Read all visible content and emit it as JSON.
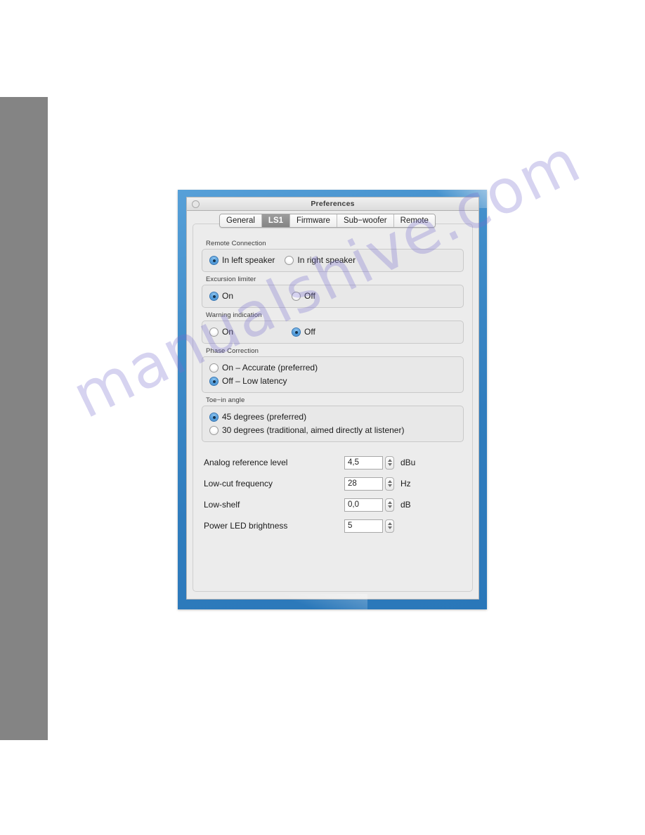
{
  "window": {
    "title": "Preferences",
    "close_button": "close-button"
  },
  "tabs": [
    {
      "label": "General",
      "selected": false
    },
    {
      "label": "LS1",
      "selected": true
    },
    {
      "label": "Firmware",
      "selected": false
    },
    {
      "label": "Sub−woofer",
      "selected": false
    },
    {
      "label": "Remote",
      "selected": false
    }
  ],
  "groups": [
    {
      "label": "Remote Connection",
      "layout": "inline",
      "options": [
        {
          "label": "In left speaker",
          "selected": true
        },
        {
          "label": "In right speaker",
          "selected": false
        }
      ]
    },
    {
      "label": "Excursion limiter",
      "layout": "columns",
      "options": [
        {
          "label": "On",
          "selected": true
        },
        {
          "label": "Off",
          "selected": false
        }
      ]
    },
    {
      "label": "Warning indication",
      "layout": "columns",
      "options": [
        {
          "label": "On",
          "selected": false
        },
        {
          "label": "Off",
          "selected": true
        }
      ]
    },
    {
      "label": "Phase Correction",
      "layout": "stacked",
      "options": [
        {
          "label": "On – Accurate (preferred)",
          "selected": false
        },
        {
          "label": "Off – Low latency",
          "selected": true
        }
      ]
    },
    {
      "label": "Toe−in angle",
      "layout": "stacked",
      "options": [
        {
          "label": "45 degrees (preferred)",
          "selected": true
        },
        {
          "label": "30 degrees (traditional, aimed directly at listener)",
          "selected": false
        }
      ]
    }
  ],
  "fields": [
    {
      "label": "Analog reference level",
      "value": "4,5",
      "unit": "dBu"
    },
    {
      "label": "Low-cut frequency",
      "value": "28",
      "unit": "Hz"
    },
    {
      "label": "Low-shelf",
      "value": "0,0",
      "unit": "dB"
    },
    {
      "label": "Power LED brightness",
      "value": "5",
      "unit": ""
    }
  ],
  "watermark": {
    "text": "manualshive.com"
  },
  "colors": {
    "window_frame_blue": "#2f7cbd",
    "radio_selected_blue": "#4f9bdb",
    "tab_selected_gray": "#8d8d8d",
    "page_strip_gray": "#848484",
    "panel_background": "#ececec",
    "watermark_purple": "#786ecd"
  }
}
